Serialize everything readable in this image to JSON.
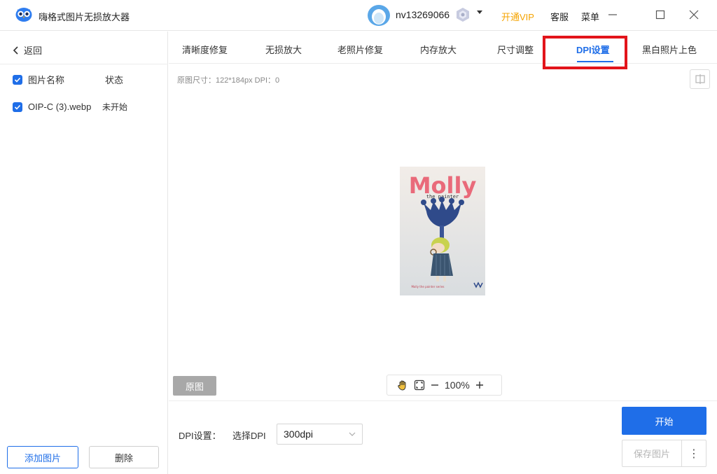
{
  "app": {
    "title": "嗨格式图片无损放大器"
  },
  "user": {
    "name": "nv13269066"
  },
  "header": {
    "vip": "开通VIP",
    "service": "客服",
    "menu": "菜单"
  },
  "sidebar": {
    "back": "返回",
    "columns": {
      "name": "图片名称",
      "status": "状态"
    },
    "files": [
      {
        "name": "OIP-C (3).webp",
        "status": "未开始"
      }
    ],
    "add_button": "添加图片",
    "delete_button": "删除"
  },
  "tabs": [
    {
      "label": "清晰度修复",
      "active": false
    },
    {
      "label": "无损放大",
      "active": false
    },
    {
      "label": "老照片修复",
      "active": false
    },
    {
      "label": "内存放大",
      "active": false
    },
    {
      "label": "尺寸调整",
      "active": false
    },
    {
      "label": "DPI设置",
      "active": true
    },
    {
      "label": "黑白照片上色",
      "active": false
    }
  ],
  "preview": {
    "info": "原图尺寸：122*184px  DPI：0",
    "original_button": "原图",
    "zoom": "100%",
    "image": {
      "title": "Molly",
      "subtitle": "the painter",
      "footer": "Molly the painter series"
    }
  },
  "settings": {
    "dpi_label": "DPI设置：",
    "select_label": "选择DPI",
    "dpi_value": "300dpi"
  },
  "actions": {
    "start": "开始",
    "save": "保存图片",
    "more": "⋮"
  },
  "colors": {
    "accent": "#1f6ee8",
    "vip": "#f5a300",
    "highlight": "#e2141b"
  }
}
